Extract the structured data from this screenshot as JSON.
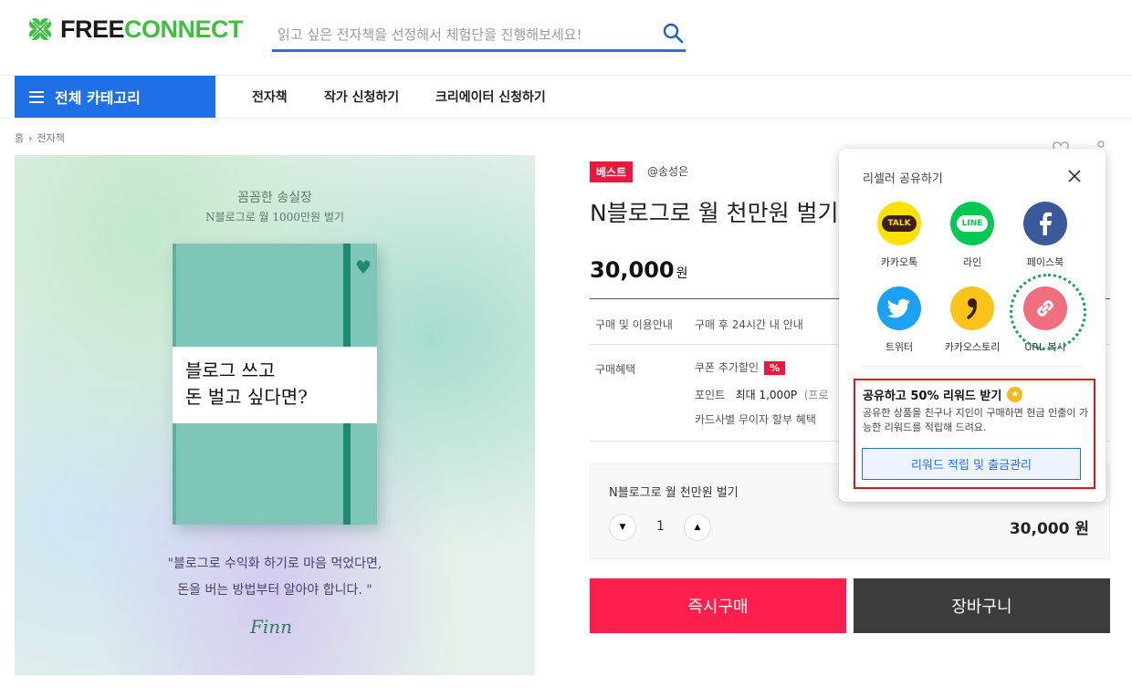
{
  "header": {
    "logo_part1": "FREE",
    "logo_part2": "CONNECT",
    "search_placeholder": "읽고 싶은 전자책을 선정해서 체험단을 진행해보세요!"
  },
  "nav": {
    "all_categories": "전체 카테고리",
    "items": [
      "전자책",
      "작가 신청하기",
      "크리에이터 신청하기"
    ]
  },
  "breadcrumb": {
    "home": "홈",
    "separator": "›",
    "current": "전자책"
  },
  "cover": {
    "author_line": "꼼꼼한 송실장",
    "subtitle": "N블로그로 월 1000만원 벌기",
    "band_line1": "블로그 쓰고",
    "band_line2": "돈 벌고 싶다면?",
    "quote_line1": "\"블로그로 수익화 하기로 마음 먹었다면,",
    "quote_line2": "돈을 버는 방법부터 알아야 합니다. \"",
    "signature": "Finn"
  },
  "product": {
    "badge": "베스트",
    "seller": "@송성은",
    "title": "N블로그로 월 천만원 벌기",
    "price": "30,000",
    "price_unit": "원",
    "info": {
      "purchase_label": "구매 및 이용안내",
      "purchase_value": "구매 후 24시간 내 안내",
      "benefit_label": "구매혜택",
      "coupon": "쿠폰 추가할인",
      "coupon_badge": "%",
      "point_label": "포인트",
      "point_value": "최대 1,000P",
      "point_note": "(프로",
      "card": "카드사별 무이자 할부 혜택"
    }
  },
  "option": {
    "name": "N블로그로 월 천만원 벌기",
    "quantity": "1",
    "price": "30,000 원"
  },
  "buttons": {
    "buy_now": "즉시구매",
    "cart": "장바구니"
  },
  "share": {
    "title": "리셀러 공유하기",
    "items": [
      {
        "label": "카카오톡",
        "icon": "kakaotalk-icon",
        "color": "#fae100"
      },
      {
        "label": "라인",
        "icon": "line-icon",
        "color": "#06c755"
      },
      {
        "label": "페이스북",
        "icon": "facebook-icon",
        "color": "#3b5998"
      },
      {
        "label": "트위터",
        "icon": "twitter-icon",
        "color": "#1da1f2"
      },
      {
        "label": "카카오스토리",
        "icon": "kakaostory-icon",
        "color": "#fcc41b"
      },
      {
        "label": "URL 복사",
        "icon": "link-icon",
        "color": "#ef6f7f"
      }
    ],
    "kakao_talk_text": "TALK",
    "line_text": "LINE",
    "reward_title": "공유하고 50% 리워드 받기",
    "reward_desc": "공유한 상품을 친구나 지인이 구매하면 현금 인출이 가능한 리워드를 적립해 드려요.",
    "reward_button": "리워드 적립 및 출금관리"
  },
  "colors": {
    "primary_blue": "#1f6fe5",
    "best_red": "#e8193c",
    "buy_red": "#ff1f4d",
    "cart_dark": "#3c3c3c",
    "logo_green": "#3fbf3f"
  }
}
